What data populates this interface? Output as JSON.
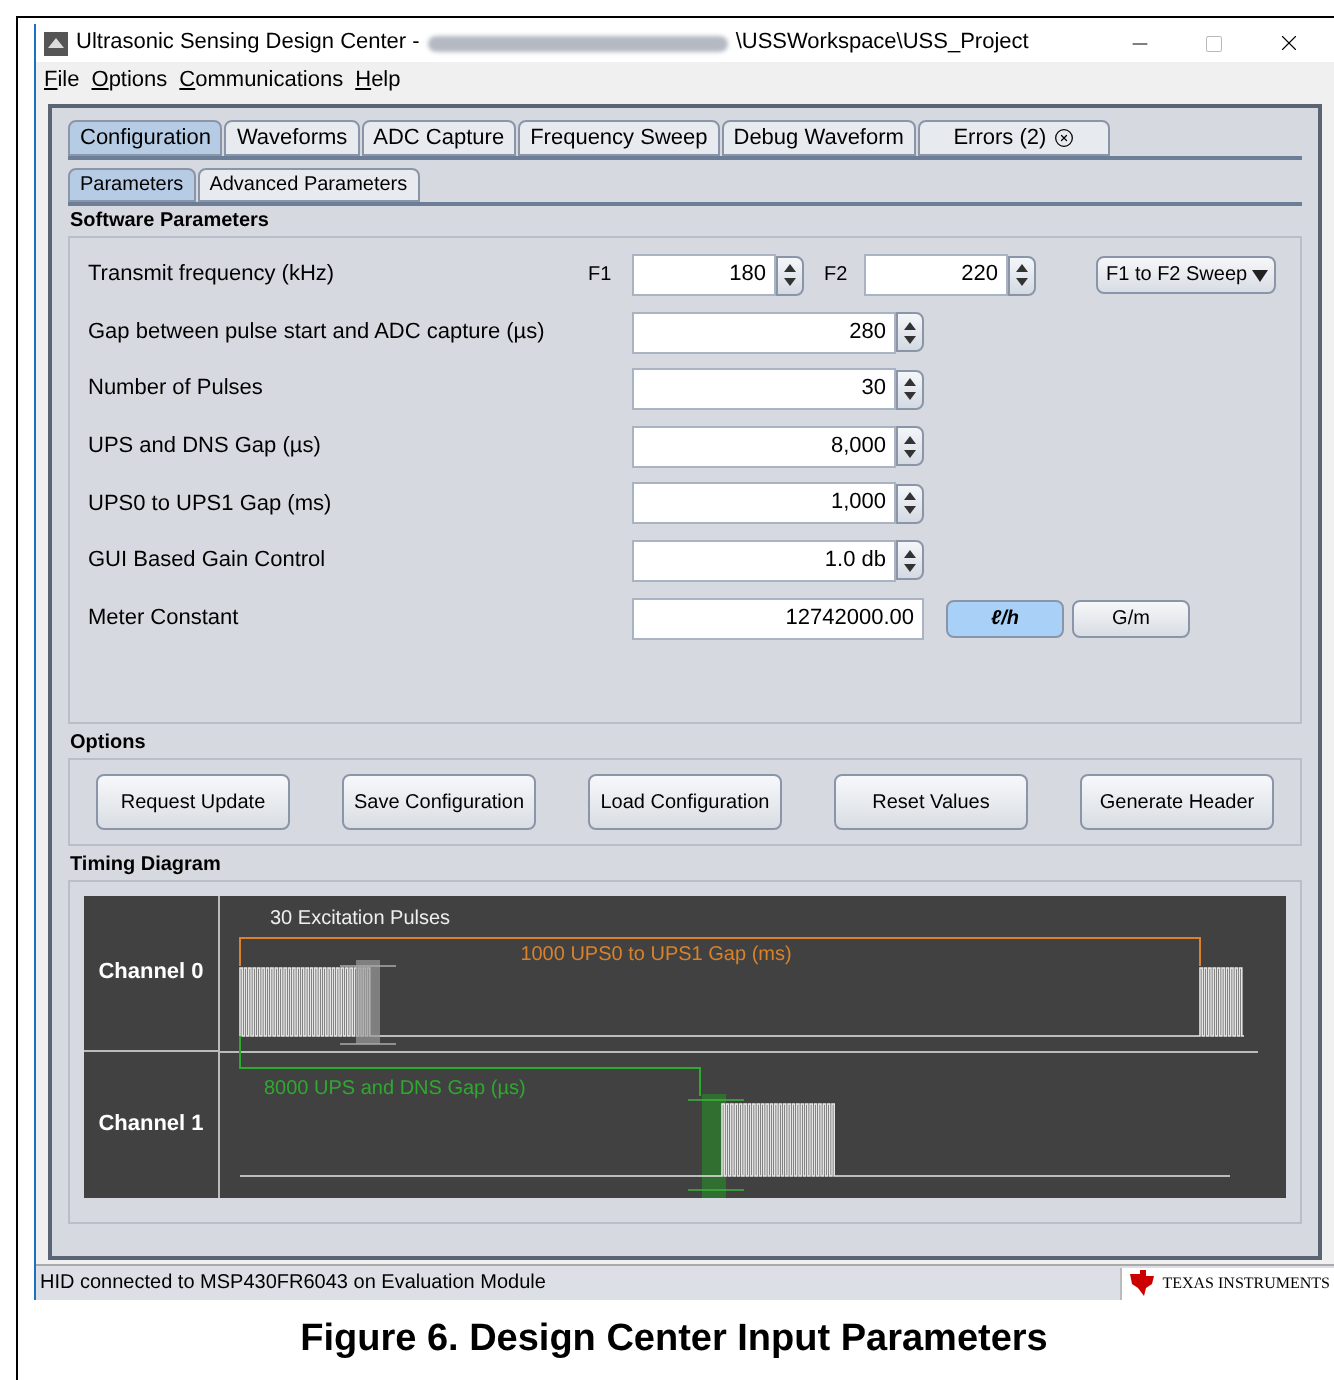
{
  "window": {
    "title_prefix": "Ultrasonic Sensing Design Center - ",
    "title_suffix": "\\USSWorkspace\\USS_Project"
  },
  "menu": [
    {
      "label": "File"
    },
    {
      "label": "Options"
    },
    {
      "label": "Communications"
    },
    {
      "label": "Help"
    }
  ],
  "tabs": [
    {
      "label": "Configuration",
      "selected": true,
      "closable": false
    },
    {
      "label": "Waveforms",
      "selected": false,
      "closable": false
    },
    {
      "label": "ADC Capture",
      "selected": false,
      "closable": false
    },
    {
      "label": "Frequency Sweep",
      "selected": false,
      "closable": false
    },
    {
      "label": "Debug Waveform",
      "selected": false,
      "closable": false
    },
    {
      "label": "Errors (2)",
      "selected": false,
      "closable": true
    }
  ],
  "subtabs": [
    {
      "label": "Parameters",
      "selected": true
    },
    {
      "label": "Advanced Parameters",
      "selected": false
    }
  ],
  "software_parameters": {
    "title": "Software Parameters",
    "transmit": {
      "label": "Transmit frequency (kHz)",
      "f1_label": "F1",
      "f1": "180",
      "f2_label": "F2",
      "f2": "220",
      "mode": "F1 to F2 Sweep"
    },
    "rows": [
      {
        "label": "Gap between pulse start and ADC capture (µs)",
        "value": "280"
      },
      {
        "label": "Number of Pulses",
        "value": "30"
      },
      {
        "label": "UPS and DNS Gap (µs)",
        "value": "8,000"
      },
      {
        "label": "UPS0 to UPS1 Gap (ms)",
        "value": "1,000"
      },
      {
        "label": "GUI Based Gain Control",
        "value": "1.0 db"
      }
    ],
    "meter": {
      "label": "Meter Constant",
      "value": "12742000.00",
      "units": [
        {
          "label": "ℓ/h",
          "selected": true
        },
        {
          "label": "G/m",
          "selected": false
        }
      ]
    }
  },
  "options": {
    "title": "Options",
    "buttons": [
      "Request Update",
      "Save Configuration",
      "Load Configuration",
      "Reset Values",
      "Generate Header"
    ]
  },
  "timing_diagram": {
    "title": "Timing Diagram",
    "channels": [
      "Channel 0",
      "Channel 1"
    ],
    "excitation_label": "30 Excitation Pulses",
    "ups_gap_label": "1000 UPS0 to UPS1 Gap (ms)",
    "dns_gap_label": "8000 UPS and DNS Gap (µs)"
  },
  "status_bar": {
    "text": "HID connected to MSP430FR6043 on Evaluation Module",
    "logo_text": "TEXAS INSTRUMENTS"
  },
  "caption": "Figure 6. Design Center Input Parameters"
}
